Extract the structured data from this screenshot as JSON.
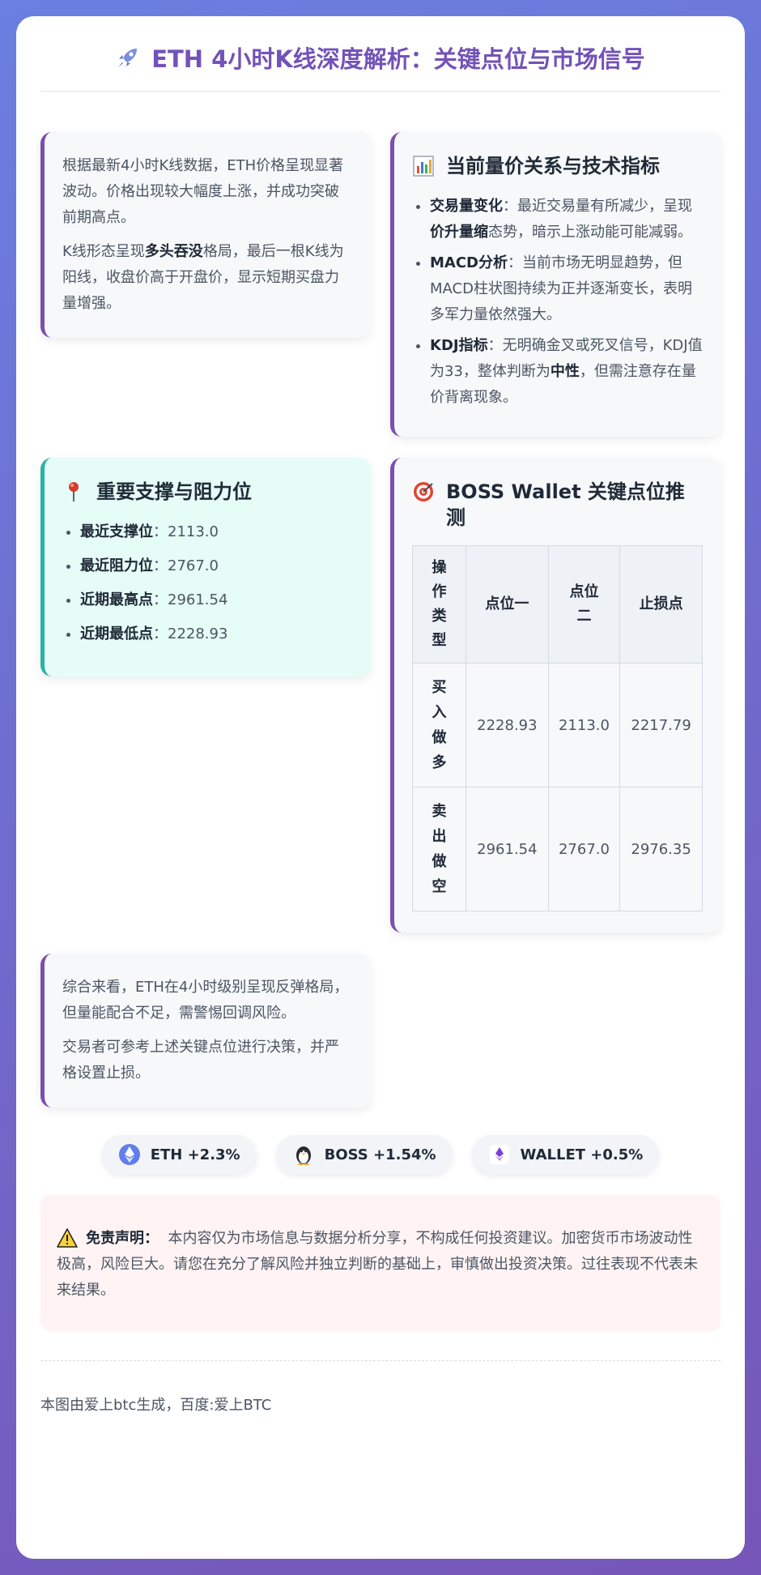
{
  "header": {
    "title": "ETH 4小时K线深度解析：关键点位与市场信号",
    "icon": "rocket-icon"
  },
  "intro": {
    "p1": "根据最新4小时K线数据，ETH价格呈现显著波动。价格出现较大幅度上涨，并成功突破前期高点。",
    "p2_pre": "K线形态呈现",
    "p2_bold": "多头吞没",
    "p2_post": "格局，最后一根K线为阳线，收盘价高于开盘价，显示短期买盘力量增强。"
  },
  "indicators": {
    "title": "当前量价关系与技术指标",
    "icon": "bar-chart-icon",
    "items": [
      {
        "label": "交易量变化",
        "pre": "：最近交易量有所减少，呈现",
        "bold": "价升量缩",
        "post": "态势，暗示上涨动能可能减弱。"
      },
      {
        "label": "MACD分析",
        "pre": "：当前市场无明显趋势，但MACD柱状图持续为正并逐渐变长，表明多军力量依然强大。",
        "bold": "",
        "post": ""
      },
      {
        "label": "KDJ指标",
        "pre": "：无明确金叉或死叉信号，KDJ值为33，整体判断为",
        "bold": "中性",
        "post": "，但需注意存在量价背离现象。"
      }
    ]
  },
  "support": {
    "title": "重要支撑与阻力位",
    "icon": "pin-icon",
    "items": [
      {
        "label": "最近支撑位",
        "value": "：2113.0"
      },
      {
        "label": "最近阻力位",
        "value": "：2767.0"
      },
      {
        "label": "近期最高点",
        "value": "：2961.54"
      },
      {
        "label": "近期最低点",
        "value": "：2228.93"
      }
    ]
  },
  "boss": {
    "title": "BOSS Wallet 关键点位推测",
    "icon": "target-icon",
    "headers": [
      "操作类型",
      "点位一",
      "点位二",
      "止损点"
    ],
    "rows": [
      [
        "买入做多",
        "2228.93",
        "2113.0",
        "2217.79"
      ],
      [
        "卖出做空",
        "2961.54",
        "2767.0",
        "2976.35"
      ]
    ]
  },
  "summary": {
    "p1": "综合来看，ETH在4小时级别呈现反弹格局，但量能配合不足，需警惕回调风险。",
    "p2": "交易者可参考上述关键点位进行决策，并严格设置止损。"
  },
  "tags": [
    {
      "label": "ETH +2.3%",
      "icon": "eth-icon"
    },
    {
      "label": "BOSS +1.54%",
      "icon": "penguin-icon"
    },
    {
      "label": "WALLET +0.5%",
      "icon": "wallet-logo-icon"
    }
  ],
  "disclaimer": {
    "label": "免责声明：",
    "text": "本内容仅为市场信息与数据分析分享，不构成任何投资建议。加密货币市场波动性极高，风险巨大。请您在充分了解风险并独立判断的基础上，审慎做出投资决策。过往表现不代表未来结果。",
    "icon": "warning-icon"
  },
  "footer": {
    "text": "本图由爱上btc生成，百度:爱上BTC"
  }
}
